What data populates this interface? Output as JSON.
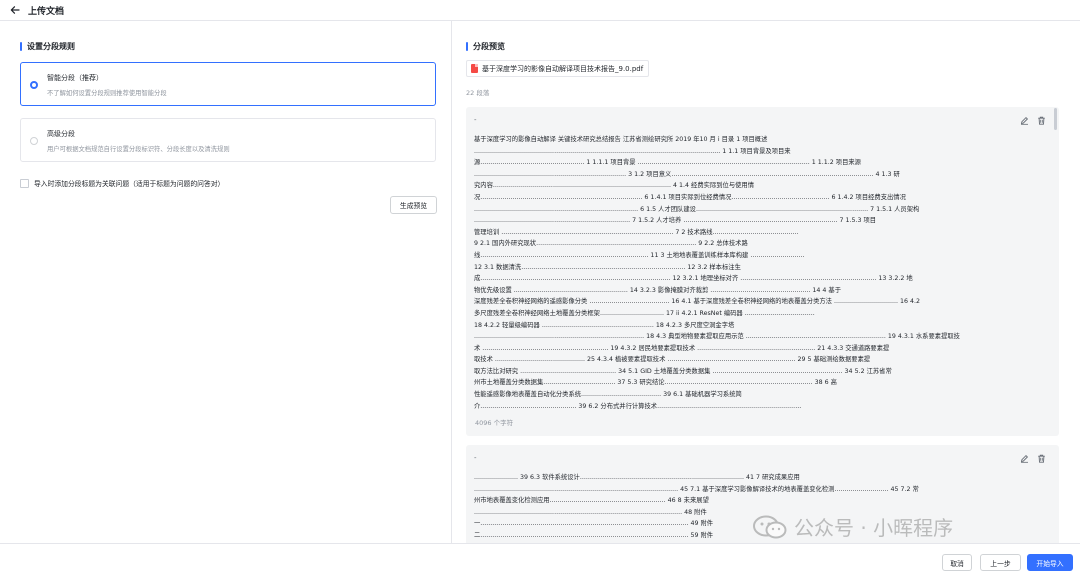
{
  "header": {
    "title": "上传文档"
  },
  "left": {
    "section_title": "设置分段规则",
    "options": [
      {
        "title": "智能分段（推荐）",
        "desc": "不了解如何设置分段规则推荐使用智能分段",
        "selected": true
      },
      {
        "title": "高级分段",
        "desc": "用户可根据文档规范自行设置分段标识符、分段长度以及清洗规则",
        "selected": false
      }
    ],
    "checkbox_label": "导入时添加分段标题为关联问题（适用于标题为问题的问答对）",
    "preview_button": "生成预览"
  },
  "right": {
    "section_title": "分段预览",
    "file_name": "基于深度学习的影像自动解译项目技术报告_9.0.pdf",
    "segment_count": "22 段落",
    "segments": [
      {
        "title": "-",
        "lines": [
          "基于深度学习的影像自动解译 关键技术研究总结报告 江苏省测绘研究所 2019 年10 月 i 目录 1 项目概述",
          "........................................................................................................................... 1 1.1 项目背景及项目来",
          "源.................................................... 1 1.1.1 项目背景 ...................................................................................... 1 1.1.2 项目来源",
          "............................................................................ 3 1.2 项目意义..................................................................................................... 4 1.3 研",
          "究内容......................................................................................... 4 1.4 经费实际到位与使用情",
          "况................................................................................. 6 1.4.1 项目实际到位经费情况................................................. 6 1.4.2 项目经费支出情况",
          ".................................................................................. 6 1.5 人才团队建设...................................................................................... 7 1.5.1 人员架构",
          ".............................................................................. 7 1.5.2 人才培养 ............................................................................. 7 1.5.3 项目",
          "管理培训 ...................................................................................... 7 2 技术路线...........................................",
          "9 2.1 国内外研究现状................................................................................ 9 2.2 总体技术路",
          "线.................................................................................... 11 3 土地地表覆盖训练样本库构建 ...........................",
          "12 3.1 数据清洗.................................................................................. 12 3.2 样本标注生",
          "成............................................................................................... 12 3.2.1 地理坐标对齐 .................................................................... 13 3.2.2 地",
          "物优先级设置 ......................................................... 14 3.2.3 影像掩膜对齐裁剪 .................................................. 14 4 基于",
          "深度残差全卷积神经网络的遥感影像分类 ........................................ 16 4.1 基于深度残差全卷积神经网络的地表覆盖分类方法 ................................ 16 4.2",
          "多尺度残差全卷积神经网络土地覆盖分类框架................................ 17 ii 4.2.1 ResNet 编码器 ...................................",
          "18 4.2.2 轻量级编码器 ........................................................ 18 4.2.3 多尺度空洞金字塔",
          "..................................................................................... 18 4.3 典型地物要素提取应用示范 ...................................................................... 19 4.3.1 水系要素提取技",
          "术 ............................................................... 19 4.3.2 居民地要素提取技术 ........................................................... 21 4.3.3 交通道路要素提",
          "取技术 ............................................. 25 4.3.4 植被要素提取技术 ................................................................ 29 5 基础测绘数据要素提",
          "取方法比对研究 ................................................ 34 5.1 GID 土地覆盖分类数据集 ................................................................. 34 5.2 江苏省常",
          "州市土地覆盖分类数据集.................................... 37 5.3 研究结论.......................................................................... 38 6 高",
          "性能遥感影像地表覆盖自动化分类系统........................................ 39 6.1 基础机器学习系统简",
          "介................................................ 39 6.2 分布式并行计算技术........................................................................"
        ],
        "chars": "4096 个字符"
      },
      {
        "title": "-",
        "lines": [
          "...................... 39 6.3 软件系统设计.................................................................................. 41 7 研究成果应用",
          "...................................................................................................... 45 7.1 基于深度学习影像解译技术的地表覆盖变化检测........................... 45 7.2 常",
          "州市地表覆盖变化检测应用.......................................................... 46 8 未来展望",
          "........................................................................................................ 48 附件",
          "一........................................................................................................ 49 附件",
          "二........................................................................................................ 59 附件"
        ]
      }
    ]
  },
  "footer": {
    "cancel": "取消",
    "prev": "上一步",
    "import": "开始导入"
  },
  "watermark": {
    "text": "公众号 · 小晖程序"
  },
  "colors": {
    "accent": "#3370ff",
    "pdf": "#f54a45",
    "card_bg": "#f4f5f6"
  }
}
